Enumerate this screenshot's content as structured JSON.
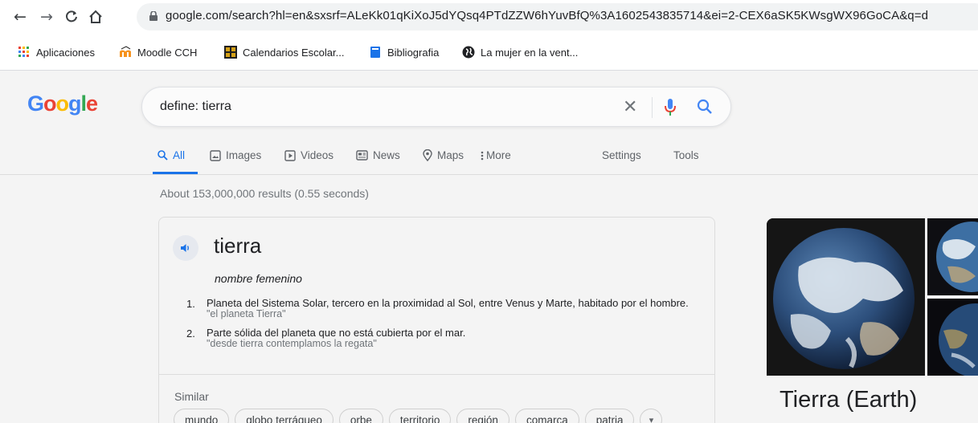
{
  "browser": {
    "url": "google.com/search?hl=en&sxsrf=ALeKk01qKiXoJ5dYQsq4PTdZZW6hYuvBfQ%3A1602543835714&ei=2-CEX6aSK5KWsgWX96GoCA&q=d",
    "bookmarks": [
      {
        "label": "Aplicaciones",
        "icon": "apps-grid-icon"
      },
      {
        "label": "Moodle CCH",
        "icon": "moodle-icon"
      },
      {
        "label": "Calendarios Escolar...",
        "icon": "unam-icon"
      },
      {
        "label": "Bibliografia",
        "icon": "book-icon"
      },
      {
        "label": "La mujer en la vent...",
        "icon": "globe-icon"
      }
    ]
  },
  "google": {
    "logo": [
      "G",
      "o",
      "o",
      "g",
      "l",
      "e"
    ],
    "logo_colors": [
      "#4285f4",
      "#ea4335",
      "#fbbc05",
      "#4285f4",
      "#34a853",
      "#ea4335"
    ],
    "query": "define: tierra",
    "tabs": {
      "all": "All",
      "images": "Images",
      "videos": "Videos",
      "news": "News",
      "maps": "Maps",
      "more": "More",
      "settings": "Settings",
      "tools": "Tools"
    },
    "result_stats": "About 153,000,000 results (0.55 seconds)"
  },
  "dictionary": {
    "word": "tierra",
    "part_of_speech": "nombre femenino",
    "definitions": [
      {
        "num": "1.",
        "text": "Planeta del Sistema Solar, tercero en la proximidad al Sol, entre Venus y Marte, habitado por el hombre.",
        "example": "\"el planeta Tierra\""
      },
      {
        "num": "2.",
        "text": "Parte sólida del planeta que no está cubierta por el mar.",
        "example": "\"desde tierra contemplamos la regata\""
      }
    ],
    "similar_label": "Similar",
    "similar": [
      "mundo",
      "globo terráqueo",
      "orbe",
      "territorio",
      "región",
      "comarca",
      "patria"
    ]
  },
  "knowledge_panel": {
    "title": "Tierra (Earth)"
  }
}
